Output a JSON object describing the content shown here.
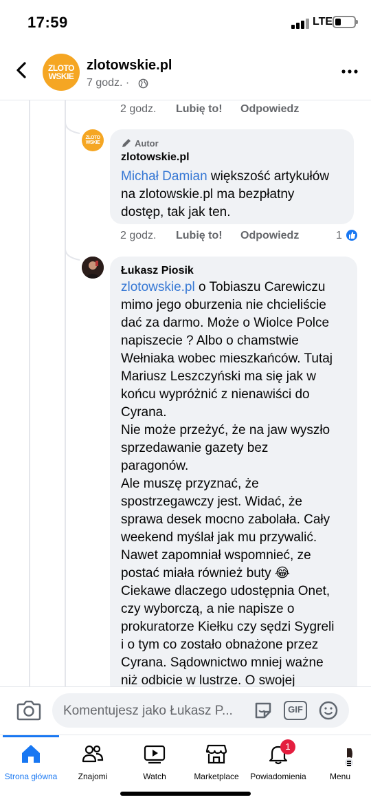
{
  "status_bar": {
    "time": "17:59",
    "network": "LTE"
  },
  "header": {
    "page_name": "zlotowskie.pl",
    "post_time": "7 godz. ·",
    "logo_line1": "ZLOTO",
    "logo_line2": "WSKIE",
    "logo_suffix": "pl"
  },
  "comments": [
    {
      "actions": {
        "time": "2 godz.",
        "like": "Lubię to!",
        "reply": "Odpowiedz"
      }
    },
    {
      "author_badge": "Autor",
      "name": "zlotowskie.pl",
      "mention": "Michał Damian",
      "text_lines": [
        " większość artykułów",
        "na zlotowskie.pl ma bezpłatny",
        "dostęp, tak jak ten."
      ],
      "actions": {
        "time": "2 godz.",
        "like": "Lubię to!",
        "reply": "Odpowiedz",
        "like_count": "1"
      }
    },
    {
      "name": "Łukasz Piosik",
      "mention": "zlotowskie.pl",
      "text_lines": [
        " o Tobiaszu Carewiczu",
        "mimo jego oburzenia nie chcieliście",
        "dać za darmo. Może o Wiolce Polce",
        "napiszecie ? Albo o chamstwie",
        "Wełniaka wobec mieszkańców. Tutaj",
        "Mariusz Leszczyński ma się jak w",
        "końcu wypróżnić z nienawiści do",
        "Cyrana.",
        "Nie może przeżyć, że na jaw wyszło",
        "sprzedawanie gazety bez",
        "paragonów.",
        "Ale muszę przyznać, że",
        "spostrzegawczy jest. Widać, że",
        "sprawa desek mocno zabolała. Cały",
        "weekend myślał jak mu przywalić.",
        "Nawet zapomniał wspomnieć, ze",
        "postać miała również buty 😂",
        "Ciekawe dlaczego udostępnia Onet,",
        "czy wyborczą, a nie napisze o",
        "prokuratorze Kiełku czy sędzi Sygreli",
        "i o tym co zostało obnażone przez",
        "Cyrana. Sądownictwo mniej ważne",
        "niż odbicie w lustrze. O swojej"
      ]
    }
  ],
  "composer": {
    "placeholder": "Komentujesz jako Łukasz P...",
    "gif_label": "GIF"
  },
  "nav": {
    "items": [
      {
        "label": "Strona główna",
        "icon": "home-icon"
      },
      {
        "label": "Znajomi",
        "icon": "friends-icon"
      },
      {
        "label": "Watch",
        "icon": "watch-icon"
      },
      {
        "label": "Marketplace",
        "icon": "marketplace-icon"
      },
      {
        "label": "Powiadomienia",
        "icon": "bell-icon",
        "badge": "1"
      },
      {
        "label": "Menu",
        "icon": "profile-menu-icon"
      }
    ]
  },
  "colors": {
    "accent": "#1877f2",
    "mention": "#3577d4",
    "logo_orange": "#f5a623",
    "bubble": "#f0f2f5"
  }
}
